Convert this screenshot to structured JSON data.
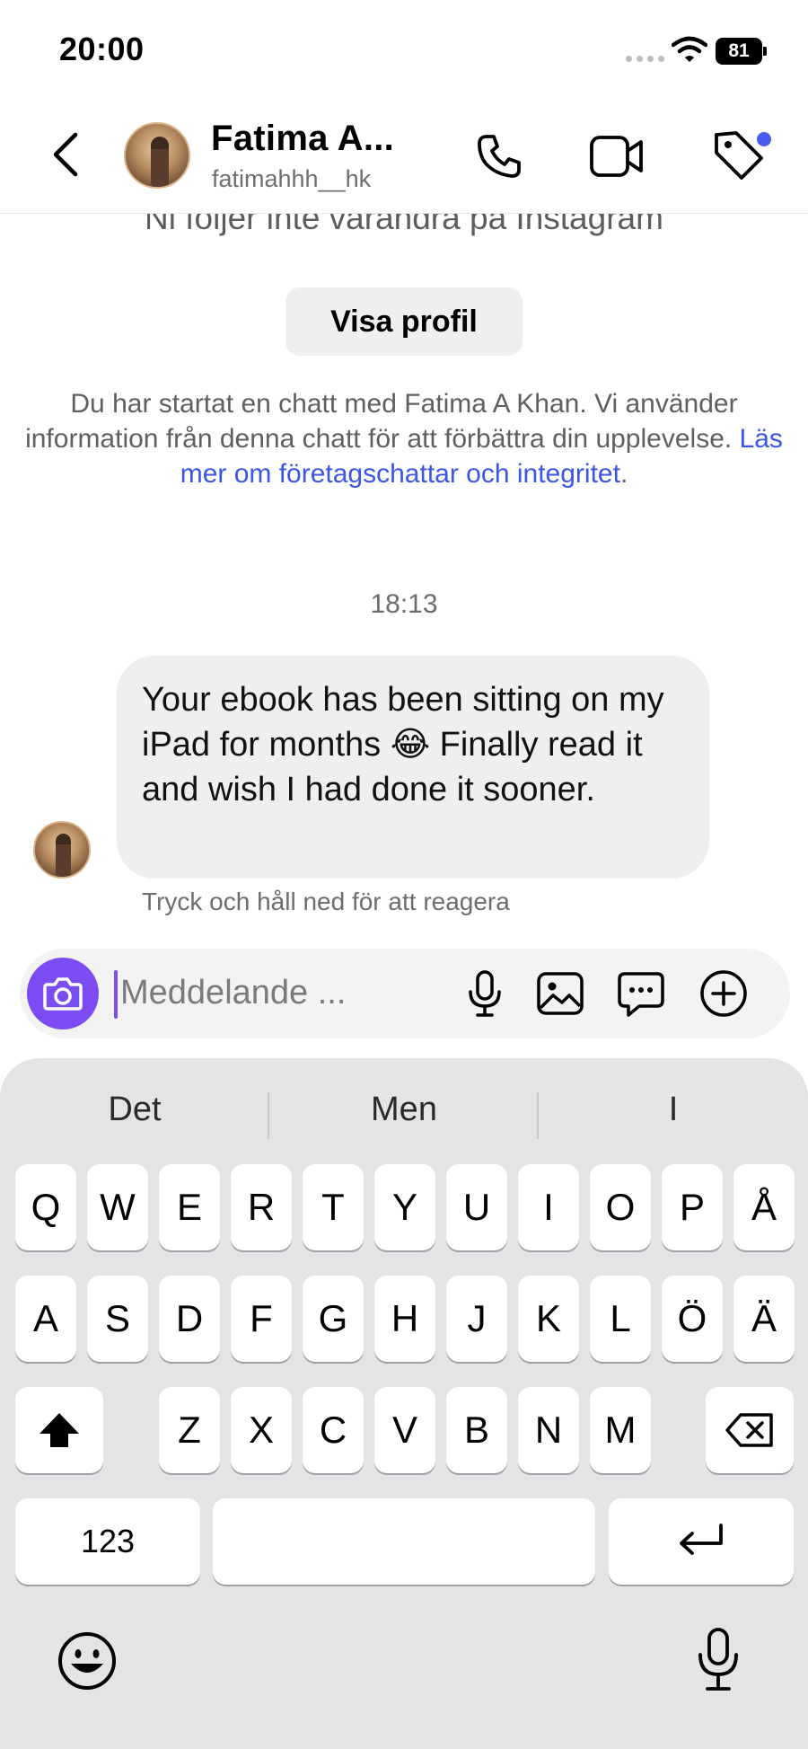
{
  "status_bar": {
    "time": "20:00",
    "battery": "81"
  },
  "header": {
    "contact_name": "Fatima A...",
    "contact_handle": "fatimahhh__hk",
    "icons": [
      "back-chevron-icon",
      "phone-icon",
      "video-camera-icon",
      "tag-icon"
    ]
  },
  "chat": {
    "follow_notice": "Ni följer inte varandra på Instagram",
    "view_profile_label": "Visa profil",
    "disclaimer_text": "Du har startat en chatt med Fatima A Khan. Vi använder information från denna chatt för att förbättra din upplevelse. ",
    "disclaimer_link": "Läs mer om företagschattar och integritet",
    "disclaimer_end": ".",
    "timestamp": "18:13",
    "messages": [
      {
        "sender": "Fatima A Khan",
        "text": "Your ebook has been sitting on my iPad for months 😂 Finally read it and wish I had done it sooner."
      }
    ],
    "react_hint": "Tryck och håll ned för att reagera"
  },
  "composer": {
    "placeholder": "Meddelande ...",
    "value": "",
    "icons": [
      "camera-icon",
      "microphone-icon",
      "gallery-icon",
      "sticker-chat-icon",
      "plus-icon"
    ]
  },
  "keyboard": {
    "suggestions": [
      "Det",
      "Men",
      "I"
    ],
    "row1": [
      "Q",
      "W",
      "E",
      "R",
      "T",
      "Y",
      "U",
      "I",
      "O",
      "P",
      "Å"
    ],
    "row2": [
      "A",
      "S",
      "D",
      "F",
      "G",
      "H",
      "J",
      "K",
      "L",
      "Ö",
      "Ä"
    ],
    "row3": [
      "Z",
      "X",
      "C",
      "V",
      "B",
      "N",
      "M"
    ],
    "numbers_label": "123"
  },
  "colors": {
    "accent": "#7b4cf2",
    "link": "#3b55e6",
    "notification_dot": "#4a5cf0",
    "bubble": "#efeff1",
    "keyboard_bg": "#e4e4e6"
  }
}
